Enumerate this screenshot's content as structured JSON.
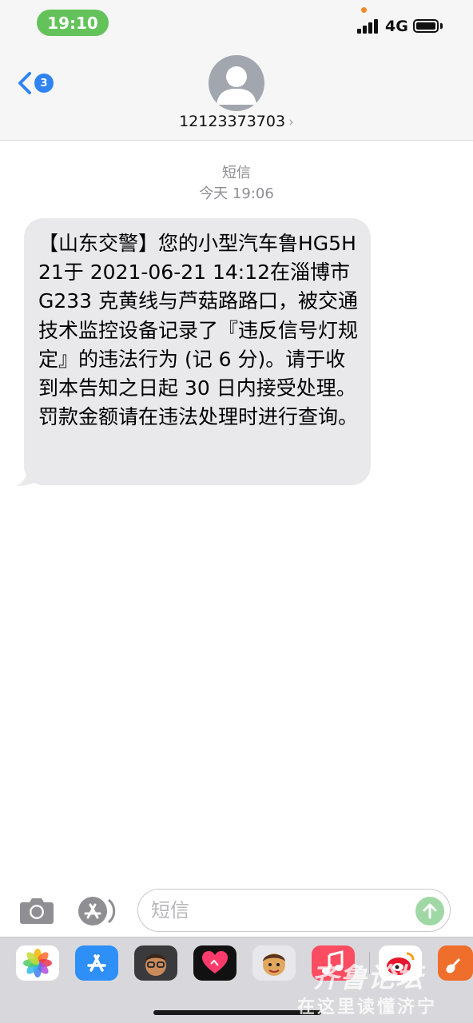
{
  "status_bar": {
    "time": "19:10",
    "network": "4G",
    "battery_level": 1.0
  },
  "header": {
    "back_badge_count": "3",
    "contact_name": "12123373703",
    "contact_chevron": "›"
  },
  "conversation": {
    "label": "短信",
    "timestamp": "今天 19:06",
    "message": "【山东交警】您的小型汽车鲁HG5H21于 2021-06-21 14:12在淄博市 G233 克黄线与芦菇路路口，被交通技术监控设备记录了『违反信号灯规定』的违法行为 (记 6 分)。请于收到本告知之日起 30 日内接受处理。罚款金额请在违法处理时进行查询。"
  },
  "input_bar": {
    "placeholder": "短信",
    "icons": [
      "camera-icon",
      "app-store-icon",
      "send-arrow-icon"
    ]
  },
  "app_drawer": {
    "apps": [
      "photos-icon",
      "app-store-icon",
      "memoji-icon",
      "digital-touch-icon",
      "animoji-icon",
      "music-icon",
      "weibo-icon",
      "garageband-icon"
    ]
  },
  "watermark": {
    "line1": "齐鲁论坛",
    "line2": "在这里读懂济宁"
  },
  "colors": {
    "status_pill": "#63c25a",
    "badge": "#2f84f2",
    "bubble": "#e9e9eb",
    "send_button": "#9fd8a4"
  }
}
